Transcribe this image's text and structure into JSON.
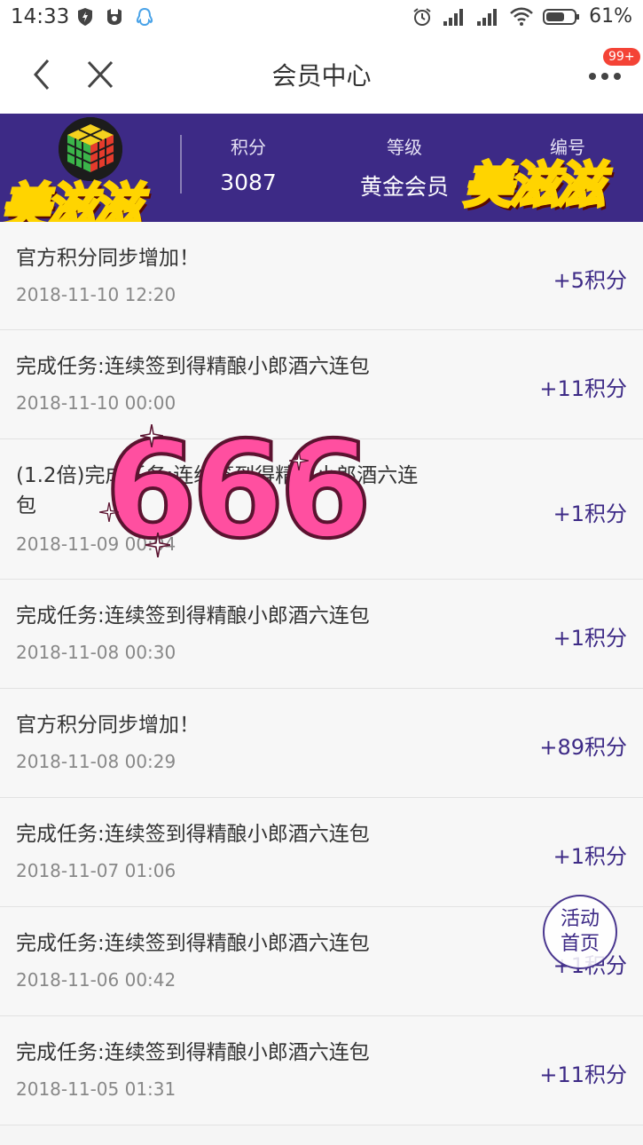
{
  "status_bar": {
    "time": "14:33",
    "battery": "61%"
  },
  "nav": {
    "title": "会员中心",
    "badge": "99+"
  },
  "member": {
    "points_label": "积分",
    "points_value": "3087",
    "level_label": "等级",
    "level_value": "黄金会员",
    "id_label": "编号"
  },
  "stickers": {
    "left": "美滋滋",
    "right": "美滋滋",
    "center": "666"
  },
  "records": [
    {
      "title": "官方积分同步增加！",
      "date": "2018-11-10 12:20",
      "points": "+5积分"
    },
    {
      "title": "完成任务:连续签到得精酿小郎酒六连包",
      "date": "2018-11-10 00:00",
      "points": "+11积分"
    },
    {
      "title": "(1.2倍)完成任务:连续签到得精酿小郎酒六连包",
      "date": "2018-11-09 00:04",
      "points": "+1积分"
    },
    {
      "title": "完成任务:连续签到得精酿小郎酒六连包",
      "date": "2018-11-08 00:30",
      "points": "+1积分"
    },
    {
      "title": "官方积分同步增加！",
      "date": "2018-11-08 00:29",
      "points": "+89积分"
    },
    {
      "title": "完成任务:连续签到得精酿小郎酒六连包",
      "date": "2018-11-07 01:06",
      "points": "+1积分"
    },
    {
      "title": "完成任务:连续签到得精酿小郎酒六连包",
      "date": "2018-11-06 00:42",
      "points": "+1积分"
    },
    {
      "title": "完成任务:连续签到得精酿小郎酒六连包",
      "date": "2018-11-05 01:31",
      "points": "+11积分"
    }
  ],
  "float_button": {
    "line1": "活动",
    "line2": "首页"
  },
  "colors": {
    "brand_purple": "#3d2a86",
    "badge_red": "#f44336"
  }
}
